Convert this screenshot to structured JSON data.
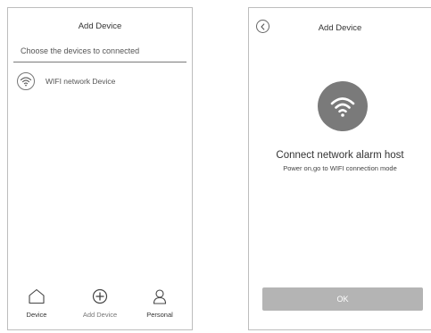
{
  "left_screen": {
    "title": "Add Device",
    "subheader": "Choose the devices to connected",
    "device_item": {
      "label": "WIFI network Device",
      "icon": "wifi-icon"
    },
    "tabbar": {
      "items": [
        {
          "label": "Device",
          "icon": "home-icon"
        },
        {
          "label": "Add Device",
          "icon": "plus-circle-icon"
        },
        {
          "label": "Personal",
          "icon": "person-icon"
        }
      ]
    }
  },
  "right_screen": {
    "title": "Add Device",
    "back_icon": "back-arrow-icon",
    "hero_icon": "wifi-icon",
    "heading": "Connect network alarm host",
    "instruction": "Power on,go to WIFI connection mode",
    "ok_label": "OK"
  },
  "colors": {
    "icon_circle": "#7a7a7a",
    "ok_button": "#b4b4b4",
    "border": "#bdbdbd"
  }
}
